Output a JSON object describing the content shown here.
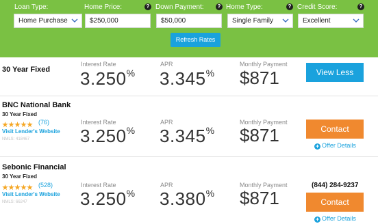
{
  "filters": {
    "loan_type": {
      "label": "Loan Type:",
      "value": "Home Purchase"
    },
    "home_price": {
      "label": "Home Price:",
      "value": "$250,000"
    },
    "down_payment": {
      "label": "Down Payment:",
      "value": "$50,000"
    },
    "home_type": {
      "label": "Home Type:",
      "value": "Single Family"
    },
    "credit_score": {
      "label": "Credit Score:",
      "value": "Excellent"
    },
    "help_glyph": "?",
    "refresh_label": "Refresh Rates",
    "colors": {
      "bar": "#7ac143",
      "accent": "#1aa2dd"
    }
  },
  "metric_labels": {
    "interest_rate": "Interest Rate",
    "apr": "APR",
    "monthly_payment": "Monthly Payment"
  },
  "percent_sign": "%",
  "rows": [
    {
      "title": "30 Year Fixed",
      "interest_rate": "3.250",
      "apr": "3.345",
      "monthly_payment": "$871",
      "action_label": "View Less"
    },
    {
      "lender": "BNC National Bank",
      "term": "30 Year Fixed",
      "rating": 5,
      "review_count": "(76)",
      "website_link": "Visit Lender's Website",
      "nmls": "NMLS: 418467",
      "interest_rate": "3.250",
      "apr": "3.345",
      "monthly_payment": "$871",
      "action_label": "Contact",
      "offer_details": "Offer Details"
    },
    {
      "lender": "Sebonic Financial",
      "term": "30 Year Fixed",
      "rating": 5,
      "review_count": "(528)",
      "website_link": "Visit Lender's Website",
      "nmls": "NMLS: 66247",
      "phone": "(844) 284-9237",
      "interest_rate": "3.250",
      "apr": "3.380",
      "monthly_payment": "$871",
      "action_label": "Contact",
      "offer_details": "Offer Details"
    }
  ]
}
